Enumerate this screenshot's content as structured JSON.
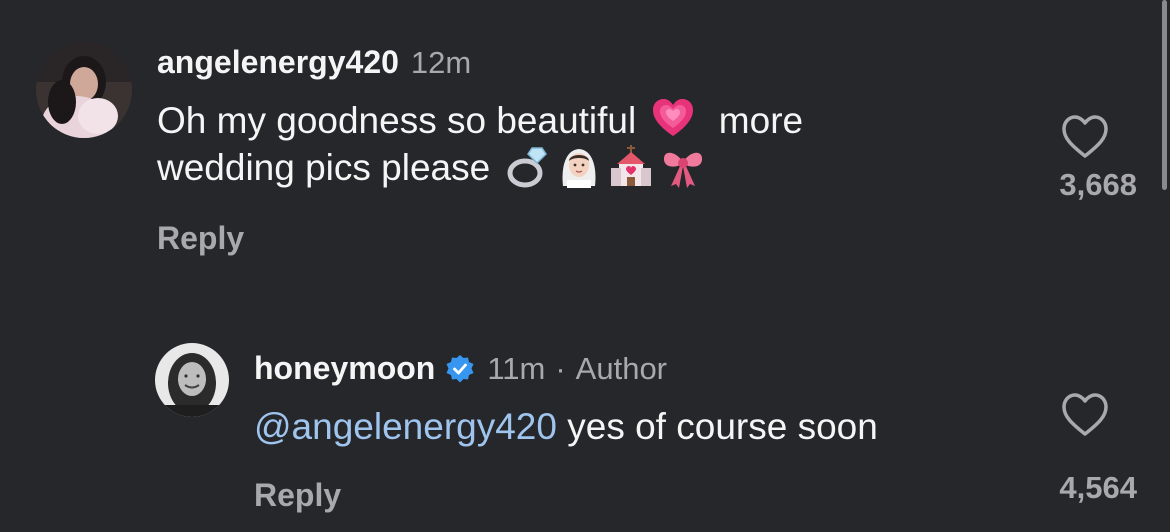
{
  "comments": [
    {
      "username": "angelenergy420",
      "time": "12m",
      "text_line1": "Oh my goodness so beautiful",
      "text_line1_after": "more",
      "text_line2": "wedding pics please",
      "emojis_line1": [
        "growing-heart-emoji"
      ],
      "emojis_line2": [
        "ring-emoji",
        "bride-emoji",
        "wedding-chapel-emoji",
        "ribbon-emoji"
      ],
      "reply_label": "Reply",
      "likes": "3,668"
    },
    {
      "username": "honeymoon",
      "verified": true,
      "time": "11m",
      "separator": "·",
      "author_label": "Author",
      "mention": "@angelenergy420",
      "text": "yes of course soon",
      "reply_label": "Reply",
      "likes": "4,564"
    }
  ],
  "colors": {
    "background": "#26272b",
    "primary_text": "#f5f5f5",
    "secondary_text": "#a8a8ad",
    "mention": "#9fc4ee",
    "verified": "#3797f0"
  }
}
